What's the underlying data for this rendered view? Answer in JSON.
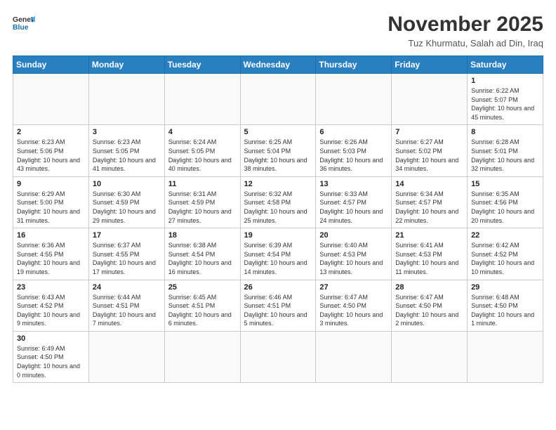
{
  "header": {
    "logo_general": "General",
    "logo_blue": "Blue",
    "month_year": "November 2025",
    "location": "Tuz Khurmatu, Salah ad Din, Iraq"
  },
  "weekdays": [
    "Sunday",
    "Monday",
    "Tuesday",
    "Wednesday",
    "Thursday",
    "Friday",
    "Saturday"
  ],
  "weeks": [
    [
      {
        "day": "",
        "info": ""
      },
      {
        "day": "",
        "info": ""
      },
      {
        "day": "",
        "info": ""
      },
      {
        "day": "",
        "info": ""
      },
      {
        "day": "",
        "info": ""
      },
      {
        "day": "",
        "info": ""
      },
      {
        "day": "1",
        "info": "Sunrise: 6:22 AM\nSunset: 5:07 PM\nDaylight: 10 hours and 45 minutes."
      }
    ],
    [
      {
        "day": "2",
        "info": "Sunrise: 6:23 AM\nSunset: 5:06 PM\nDaylight: 10 hours and 43 minutes."
      },
      {
        "day": "3",
        "info": "Sunrise: 6:23 AM\nSunset: 5:05 PM\nDaylight: 10 hours and 41 minutes."
      },
      {
        "day": "4",
        "info": "Sunrise: 6:24 AM\nSunset: 5:05 PM\nDaylight: 10 hours and 40 minutes."
      },
      {
        "day": "5",
        "info": "Sunrise: 6:25 AM\nSunset: 5:04 PM\nDaylight: 10 hours and 38 minutes."
      },
      {
        "day": "6",
        "info": "Sunrise: 6:26 AM\nSunset: 5:03 PM\nDaylight: 10 hours and 36 minutes."
      },
      {
        "day": "7",
        "info": "Sunrise: 6:27 AM\nSunset: 5:02 PM\nDaylight: 10 hours and 34 minutes."
      },
      {
        "day": "8",
        "info": "Sunrise: 6:28 AM\nSunset: 5:01 PM\nDaylight: 10 hours and 32 minutes."
      }
    ],
    [
      {
        "day": "9",
        "info": "Sunrise: 6:29 AM\nSunset: 5:00 PM\nDaylight: 10 hours and 31 minutes."
      },
      {
        "day": "10",
        "info": "Sunrise: 6:30 AM\nSunset: 4:59 PM\nDaylight: 10 hours and 29 minutes."
      },
      {
        "day": "11",
        "info": "Sunrise: 6:31 AM\nSunset: 4:59 PM\nDaylight: 10 hours and 27 minutes."
      },
      {
        "day": "12",
        "info": "Sunrise: 6:32 AM\nSunset: 4:58 PM\nDaylight: 10 hours and 25 minutes."
      },
      {
        "day": "13",
        "info": "Sunrise: 6:33 AM\nSunset: 4:57 PM\nDaylight: 10 hours and 24 minutes."
      },
      {
        "day": "14",
        "info": "Sunrise: 6:34 AM\nSunset: 4:57 PM\nDaylight: 10 hours and 22 minutes."
      },
      {
        "day": "15",
        "info": "Sunrise: 6:35 AM\nSunset: 4:56 PM\nDaylight: 10 hours and 20 minutes."
      }
    ],
    [
      {
        "day": "16",
        "info": "Sunrise: 6:36 AM\nSunset: 4:55 PM\nDaylight: 10 hours and 19 minutes."
      },
      {
        "day": "17",
        "info": "Sunrise: 6:37 AM\nSunset: 4:55 PM\nDaylight: 10 hours and 17 minutes."
      },
      {
        "day": "18",
        "info": "Sunrise: 6:38 AM\nSunset: 4:54 PM\nDaylight: 10 hours and 16 minutes."
      },
      {
        "day": "19",
        "info": "Sunrise: 6:39 AM\nSunset: 4:54 PM\nDaylight: 10 hours and 14 minutes."
      },
      {
        "day": "20",
        "info": "Sunrise: 6:40 AM\nSunset: 4:53 PM\nDaylight: 10 hours and 13 minutes."
      },
      {
        "day": "21",
        "info": "Sunrise: 6:41 AM\nSunset: 4:53 PM\nDaylight: 10 hours and 11 minutes."
      },
      {
        "day": "22",
        "info": "Sunrise: 6:42 AM\nSunset: 4:52 PM\nDaylight: 10 hours and 10 minutes."
      }
    ],
    [
      {
        "day": "23",
        "info": "Sunrise: 6:43 AM\nSunset: 4:52 PM\nDaylight: 10 hours and 9 minutes."
      },
      {
        "day": "24",
        "info": "Sunrise: 6:44 AM\nSunset: 4:51 PM\nDaylight: 10 hours and 7 minutes."
      },
      {
        "day": "25",
        "info": "Sunrise: 6:45 AM\nSunset: 4:51 PM\nDaylight: 10 hours and 6 minutes."
      },
      {
        "day": "26",
        "info": "Sunrise: 6:46 AM\nSunset: 4:51 PM\nDaylight: 10 hours and 5 minutes."
      },
      {
        "day": "27",
        "info": "Sunrise: 6:47 AM\nSunset: 4:50 PM\nDaylight: 10 hours and 3 minutes."
      },
      {
        "day": "28",
        "info": "Sunrise: 6:47 AM\nSunset: 4:50 PM\nDaylight: 10 hours and 2 minutes."
      },
      {
        "day": "29",
        "info": "Sunrise: 6:48 AM\nSunset: 4:50 PM\nDaylight: 10 hours and 1 minute."
      }
    ],
    [
      {
        "day": "30",
        "info": "Sunrise: 6:49 AM\nSunset: 4:50 PM\nDaylight: 10 hours and 0 minutes."
      },
      {
        "day": "",
        "info": ""
      },
      {
        "day": "",
        "info": ""
      },
      {
        "day": "",
        "info": ""
      },
      {
        "day": "",
        "info": ""
      },
      {
        "day": "",
        "info": ""
      },
      {
        "day": "",
        "info": ""
      }
    ]
  ]
}
